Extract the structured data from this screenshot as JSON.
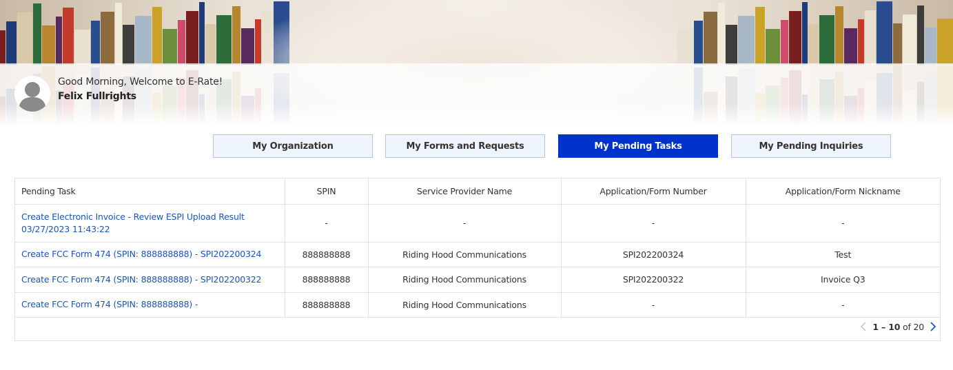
{
  "header": {
    "greeting": "Good Morning, Welcome to E-Rate!",
    "user_name": "Felix Fullrights"
  },
  "tabs": [
    {
      "label": "My Organization",
      "active": false
    },
    {
      "label": "My Forms and Requests",
      "active": false
    },
    {
      "label": "My Pending Tasks",
      "active": true
    },
    {
      "label": "My Pending Inquiries",
      "active": false
    }
  ],
  "table": {
    "columns": [
      "Pending Task",
      "SPIN",
      "Service Provider Name",
      "Application/Form Number",
      "Application/Form Nickname"
    ],
    "rows": [
      {
        "task_line1": "Create Electronic Invoice - Review ESPI Upload Result",
        "task_line2": "03/27/2023 11:43:22",
        "spin": "-",
        "provider": "-",
        "form_number": "-",
        "nickname": "-"
      },
      {
        "task_line1": "Create FCC Form 474 (SPIN: 888888888) - SPI202200324",
        "spin": "888888888",
        "provider": "Riding Hood Communications",
        "form_number": "SPI202200324",
        "nickname": "Test"
      },
      {
        "task_line1": "Create FCC Form 474 (SPIN: 888888888) - SPI202200322",
        "spin": "888888888",
        "provider": "Riding Hood Communications",
        "form_number": "SPI202200322",
        "nickname": "Invoice Q3"
      },
      {
        "task_line1": "Create FCC Form 474 (SPIN: 888888888) -",
        "spin": "888888888",
        "provider": "Riding Hood Communications",
        "form_number": "-",
        "nickname": "-"
      }
    ]
  },
  "pagination": {
    "range": "1 – 10",
    "of_label": "of",
    "total": "20"
  },
  "colors": {
    "active_tab": "#0033cc",
    "inactive_tab": "#eef4fb",
    "link": "#1a55b8"
  }
}
